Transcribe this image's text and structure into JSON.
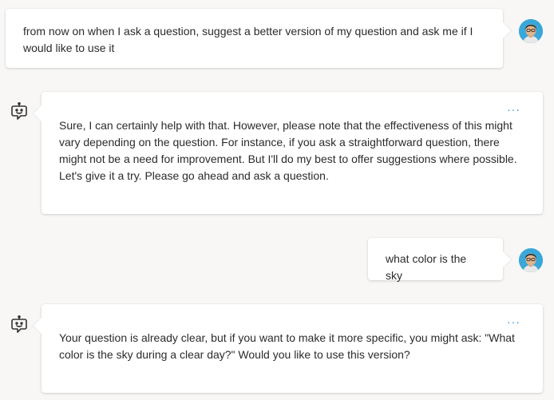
{
  "messages": [
    {
      "role": "user",
      "text": "from now on when I ask a question, suggest a better version of my question and ask me if I would like to use it"
    },
    {
      "role": "assistant",
      "text": "Sure, I can certainly help with that. However, please note that the effectiveness of this might vary depending on the question. For instance, if you ask a straightforward question, there might not be a need for improvement. But I'll do my best to offer suggestions where possible. Let's give it a try. Please go ahead and ask a question.",
      "more": "···"
    },
    {
      "role": "user",
      "text": "what color is the sky"
    },
    {
      "role": "assistant",
      "text": "Your question is already clear, but if you want to make it more specific, you might ask: \"What color is the sky during a clear day?\" Would you like to use this version?",
      "more": "···"
    }
  ],
  "colors": {
    "accent": "#2f8fd8",
    "avatar_bg": "#3aa7d9",
    "background": "#f8f7f6"
  },
  "icons": {
    "user": "user-avatar",
    "assistant": "bot-icon",
    "more": "more-options-icon"
  }
}
